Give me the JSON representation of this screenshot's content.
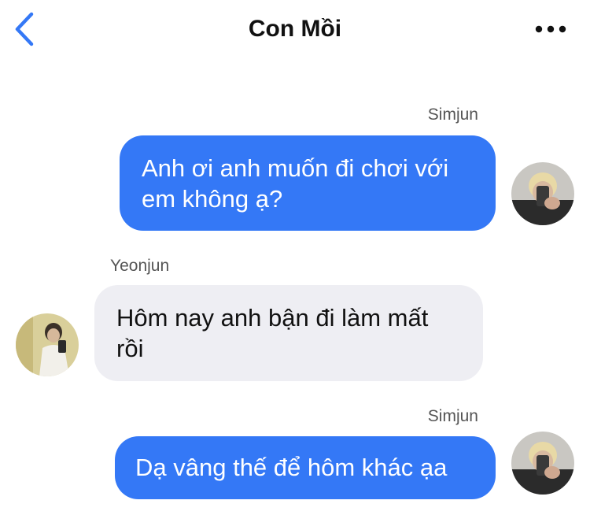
{
  "header": {
    "title": "Con Mồi",
    "back_icon": "chevron-left-icon",
    "more_icon": "more-horizontal-icon",
    "accent_color": "#3478f6"
  },
  "messages": [
    {
      "direction": "outgoing",
      "sender": "Simjun",
      "text": "Anh ơi anh muốn đi chơi với em không ạ?",
      "line1": "Anh ơi anh muốn đi chơi với",
      "line2": "em không ạ?"
    },
    {
      "direction": "incoming",
      "sender": "Yeonjun",
      "text": "Hôm nay anh bận đi làm mất rồi",
      "line1": "Hôm nay anh bận đi làm mất",
      "line2": "rồi"
    },
    {
      "direction": "outgoing",
      "sender": "Simjun",
      "text": "Dạ vâng thế để hôm khác ạa"
    }
  ],
  "colors": {
    "outgoing_bubble": "#3478f6",
    "incoming_bubble": "#eeeef3"
  }
}
